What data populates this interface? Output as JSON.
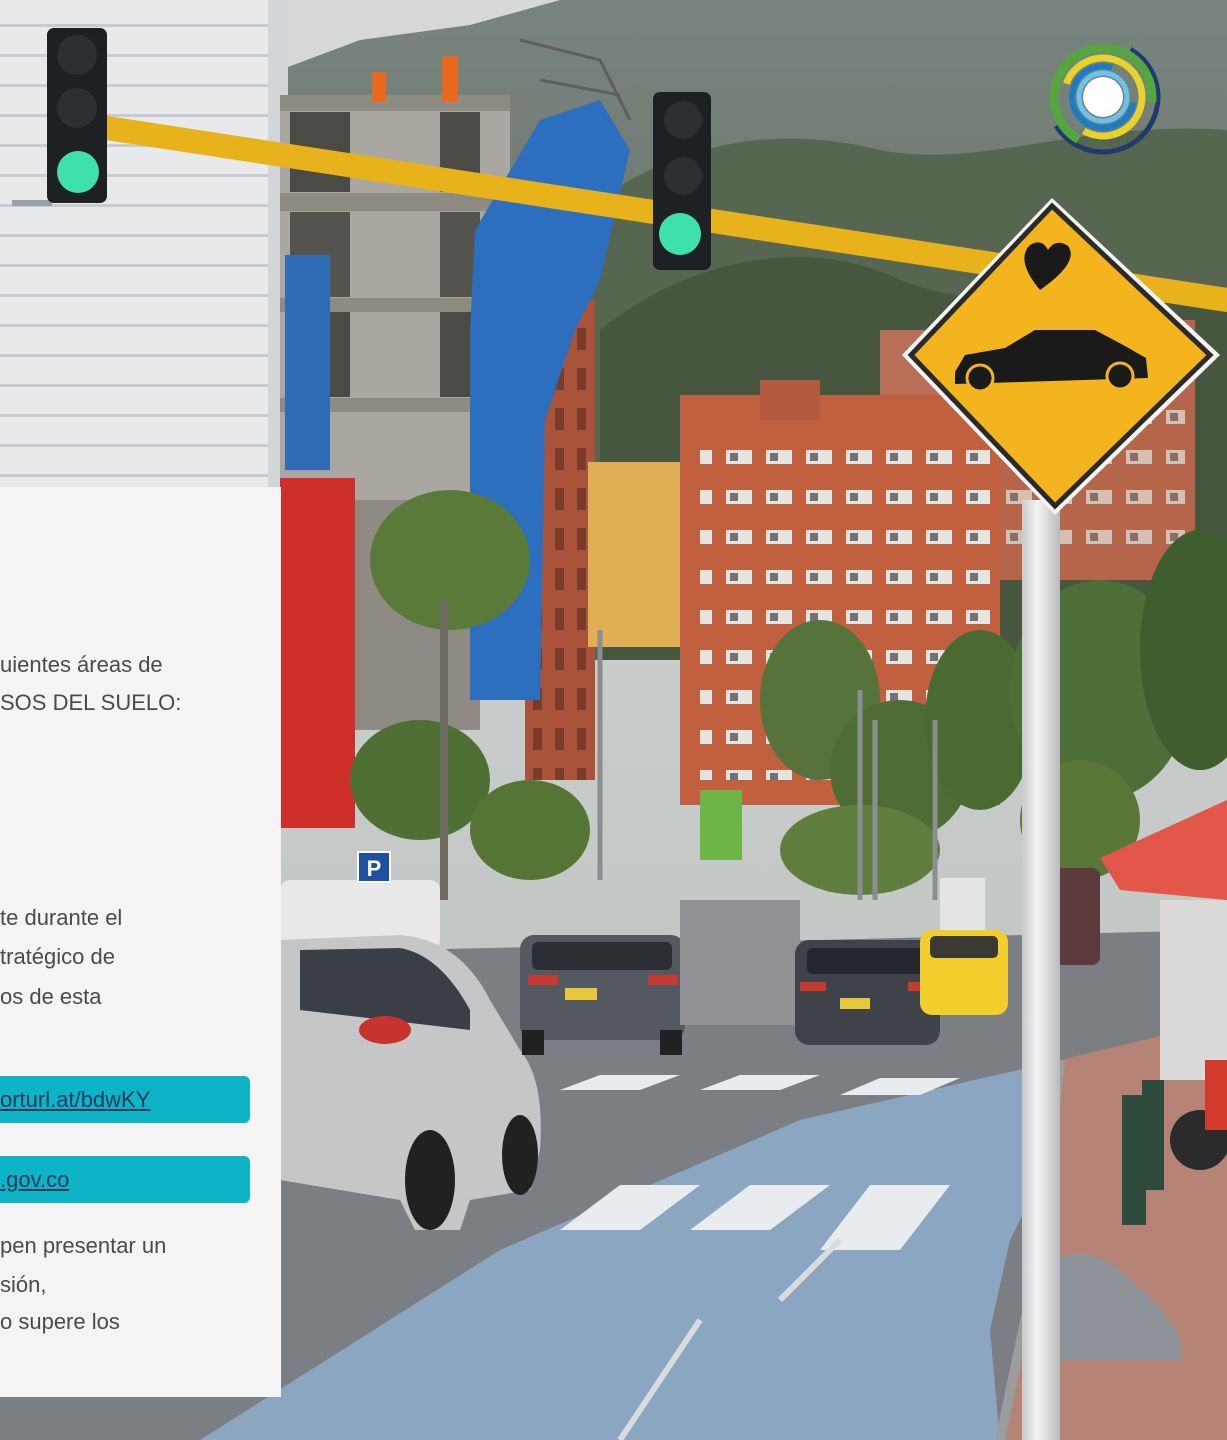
{
  "colors": {
    "card_bg": "#f4f4f4",
    "text": "#4a4a4a",
    "button_bg": "#0db3c6",
    "button_text": "#1b3a5c",
    "sign_yellow": "#f3b41d",
    "pole_yellow": "#e8b21a",
    "traffic_green": "#3fe0b0"
  },
  "logo": {
    "icon": "circular-rings-logo"
  },
  "card": {
    "paragraph1": [
      "uientes áreas de",
      "SOS DEL SUELO:"
    ],
    "paragraph2": [
      "te durante el",
      "tratégico de",
      "os de esta"
    ],
    "links": [
      {
        "label": "orturl.at/bdwKY"
      },
      {
        "label": ".gov.co"
      }
    ],
    "paragraph3": [
      "pen presentar un",
      "sión,",
      "o supere los"
    ]
  },
  "scene": {
    "parking_sign_label": "P",
    "icons": [
      "traffic-light-icon",
      "car-crossing-sign-icon",
      "parking-sign-icon"
    ]
  }
}
